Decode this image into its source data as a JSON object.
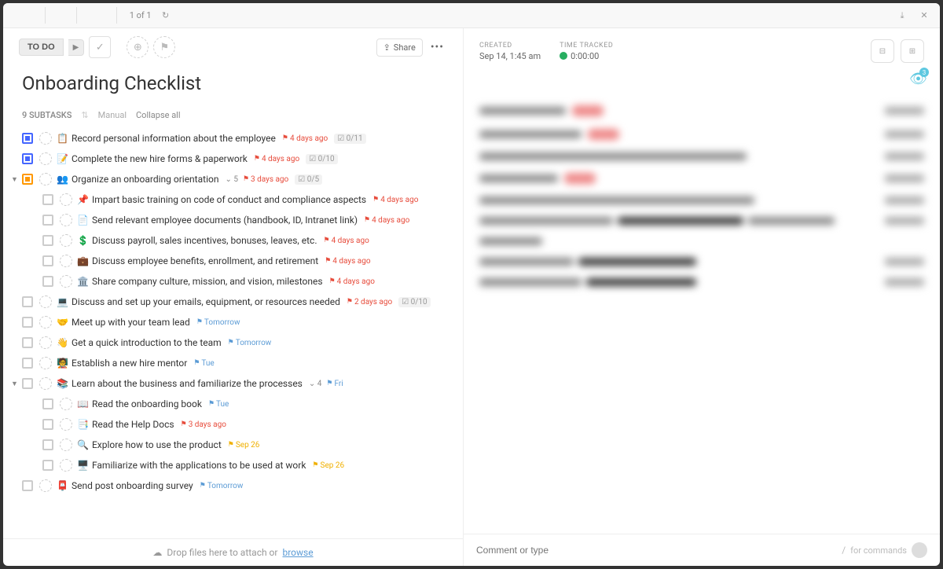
{
  "tabs": [
    "",
    "",
    ""
  ],
  "pager": "1 of 1",
  "status_label": "TO DO",
  "share_label": "Share",
  "title": "Onboarding Checklist",
  "subtask_count": "9 SUBTASKS",
  "sort_label": "Manual",
  "collapse_label": "Collapse all",
  "tasks": [
    {
      "color": "blue",
      "emoji": "📋",
      "title": "Record personal information about the employee",
      "flag": "red",
      "due": "4 days ago",
      "progress": "0/11"
    },
    {
      "color": "blue",
      "emoji": "📝",
      "title": "Complete the new hire forms & paperwork",
      "flag": "red",
      "due": "4 days ago",
      "progress": "0/10"
    },
    {
      "color": "orange",
      "expand": true,
      "emoji": "👥",
      "title": "Organize an onboarding orientation",
      "sub": "5",
      "flag": "red",
      "due": "3 days ago",
      "progress": "0/5",
      "children": [
        {
          "emoji": "📌",
          "title": "Impart basic training on code of conduct and compliance aspects",
          "flag": "red",
          "due": "4 days ago"
        },
        {
          "emoji": "📄",
          "title": "Send relevant employee documents (handbook, ID, Intranet link)",
          "flag": "red",
          "due": "4 days ago"
        },
        {
          "emoji": "💲",
          "title": "Discuss payroll, sales incentives, bonuses, leaves, etc.",
          "flag": "red",
          "due": "4 days ago"
        },
        {
          "emoji": "💼",
          "title": "Discuss employee benefits, enrollment, and retirement",
          "flag": "red",
          "due": "4 days ago"
        },
        {
          "emoji": "🏛️",
          "title": "Share company culture, mission, and vision, milestones",
          "flag": "red",
          "due": "4 days ago"
        }
      ]
    },
    {
      "emoji": "💻",
      "title": "Discuss and set up your emails, equipment, or resources needed",
      "flag": "red",
      "due": "2 days ago",
      "progress": "0/10"
    },
    {
      "emoji": "🤝",
      "title": "Meet up with your team lead",
      "flag": "blue",
      "due": "Tomorrow"
    },
    {
      "emoji": "👋",
      "title": "Get a quick introduction to the team",
      "flag": "blue",
      "due": "Tomorrow"
    },
    {
      "emoji": "🧑‍🏫",
      "title": "Establish a new hire mentor",
      "flag": "blue",
      "due": "Tue"
    },
    {
      "expand": true,
      "emoji": "📚",
      "title": "Learn about the business and familiarize the processes",
      "sub": "4",
      "flag": "blue",
      "due": "Fri",
      "children": [
        {
          "emoji": "📖",
          "title": "Read the onboarding book",
          "flag": "blue",
          "due": "Tue"
        },
        {
          "emoji": "📑",
          "title": "Read the Help Docs",
          "flag": "red",
          "due": "3 days ago"
        },
        {
          "emoji": "🔍",
          "title": "Explore how to use the product",
          "flag": "yellow",
          "due": "Sep 26"
        },
        {
          "emoji": "🖥️",
          "title": "Familiarize with the applications to be used at work",
          "flag": "yellow",
          "due": "Sep 26"
        }
      ]
    },
    {
      "emoji": "📮",
      "title": "Send post onboarding survey",
      "flag": "blue",
      "due": "Tomorrow"
    }
  ],
  "created_label": "CREATED",
  "created_value": "Sep 14, 1:45 am",
  "time_label": "TIME TRACKED",
  "time_value": "0:00:00",
  "watch_count": "3",
  "drop_text": "Drop files here to attach or ",
  "browse_text": "browse",
  "comment_placeholder": "Comment or type",
  "slash_hint": "/",
  "commands_hint": "for commands"
}
